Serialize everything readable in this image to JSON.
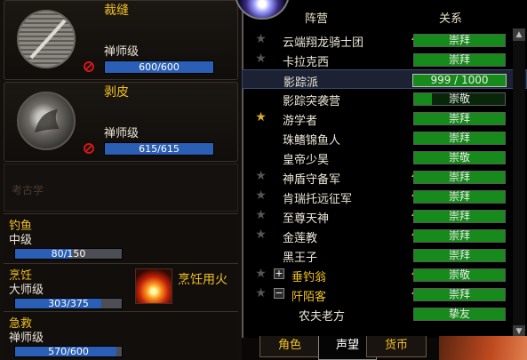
{
  "colors": {
    "gold": "#f0c020",
    "rep_green": "#168a1a",
    "skill_blue": "#2a5fb5"
  },
  "professions": [
    {
      "name": "裁缝",
      "rank": "禅师级",
      "value_text": "600/600",
      "fraction": 1.0,
      "icon": "tailoring-icon"
    },
    {
      "name": "剥皮",
      "rank": "禅师级",
      "value_text": "615/615",
      "fraction": 1.0,
      "icon": "skinning-icon"
    }
  ],
  "archaeology": {
    "label": "考古学"
  },
  "secondary": [
    {
      "name": "钓鱼",
      "rank": "中级",
      "value_text": "80/150",
      "fraction": 0.53
    },
    {
      "name": "烹饪",
      "rank": "大师级",
      "value_text": "303/375",
      "fraction": 0.81
    },
    {
      "name": "急救",
      "rank": "禅师级",
      "value_text": "570/600",
      "fraction": 0.95
    }
  ],
  "cooking_fire": {
    "label": "烹饪用火",
    "icon": "cooking-fire-icon"
  },
  "reputation": {
    "col_faction": "阵营",
    "col_standing": "关系",
    "rows": [
      {
        "name": "云端翔龙骑士团",
        "standing": "崇拜",
        "fraction": 1.0,
        "star": true,
        "star_on": false,
        "arrow": true,
        "gold": false,
        "expand": "",
        "indent": 0
      },
      {
        "name": "卡拉克西",
        "standing": "崇拜",
        "fraction": 1.0,
        "star": true,
        "star_on": false,
        "arrow": false,
        "gold": false,
        "expand": "",
        "indent": 0
      },
      {
        "name": "影踪派",
        "standing": "999 / 1000",
        "fraction": 1.0,
        "star": false,
        "star_on": false,
        "arrow": true,
        "gold": false,
        "expand": "",
        "indent": 0,
        "selected": true
      },
      {
        "name": "影踪突袭营",
        "standing": "崇敬",
        "fraction": 0.2,
        "star": false,
        "star_on": false,
        "arrow": false,
        "gold": false,
        "expand": "",
        "indent": 0
      },
      {
        "name": "游学者",
        "standing": "崇拜",
        "fraction": 1.0,
        "star": true,
        "star_on": true,
        "arrow": false,
        "gold": false,
        "expand": "",
        "indent": 0
      },
      {
        "name": "珠鳍锦鱼人",
        "standing": "崇拜",
        "fraction": 1.0,
        "star": false,
        "star_on": false,
        "arrow": false,
        "gold": false,
        "expand": "",
        "indent": 0
      },
      {
        "name": "皇帝少昊",
        "standing": "崇敬",
        "fraction": 1.0,
        "star": false,
        "star_on": false,
        "arrow": false,
        "gold": false,
        "expand": "",
        "indent": 0
      },
      {
        "name": "神盾守备军",
        "standing": "崇拜",
        "fraction": 1.0,
        "star": true,
        "star_on": false,
        "arrow": true,
        "gold": false,
        "expand": "",
        "indent": 0
      },
      {
        "name": "肯瑞托远征军",
        "standing": "崇拜",
        "fraction": 1.0,
        "star": true,
        "star_on": false,
        "arrow": true,
        "gold": false,
        "expand": "",
        "indent": 0
      },
      {
        "name": "至尊天神",
        "standing": "崇拜",
        "fraction": 1.0,
        "star": true,
        "star_on": false,
        "arrow": true,
        "gold": false,
        "expand": "",
        "indent": 0
      },
      {
        "name": "金莲教",
        "standing": "崇拜",
        "fraction": 1.0,
        "star": true,
        "star_on": false,
        "arrow": true,
        "gold": false,
        "expand": "",
        "indent": 0
      },
      {
        "name": "黑王子",
        "standing": "崇拜",
        "fraction": 1.0,
        "star": false,
        "star_on": false,
        "arrow": false,
        "gold": false,
        "expand": "",
        "indent": 0
      },
      {
        "name": "垂钓翁",
        "standing": "崇敬",
        "fraction": 1.0,
        "star": true,
        "star_on": false,
        "arrow": true,
        "gold": true,
        "expand": "+",
        "indent": 1
      },
      {
        "name": "阡陌客",
        "standing": "崇拜",
        "fraction": 1.0,
        "star": true,
        "star_on": false,
        "arrow": true,
        "gold": true,
        "expand": "−",
        "indent": 1
      },
      {
        "name": "农夫老方",
        "standing": "挚友",
        "fraction": 1.0,
        "star": false,
        "star_on": false,
        "arrow": false,
        "gold": false,
        "expand": "",
        "indent": 2
      }
    ]
  },
  "tabs": [
    {
      "label": "角色",
      "active": false
    },
    {
      "label": "声望",
      "active": true
    },
    {
      "label": "货币",
      "active": false
    }
  ]
}
